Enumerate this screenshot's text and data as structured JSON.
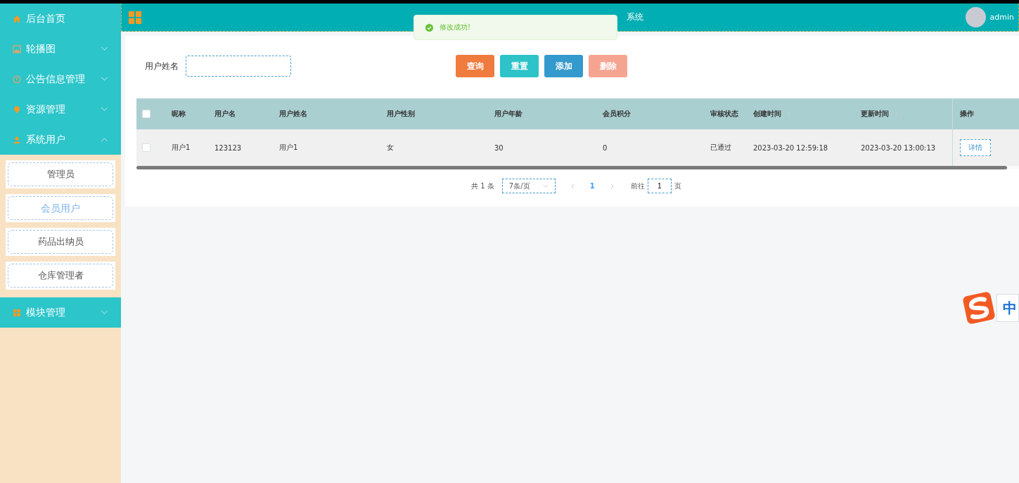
{
  "sidebar": {
    "items": [
      {
        "label": "后台首页",
        "kind": "link"
      },
      {
        "label": "轮播图",
        "kind": "submenu",
        "expanded": false
      },
      {
        "label": "公告信息管理",
        "kind": "submenu",
        "expanded": false
      },
      {
        "label": "资源管理",
        "kind": "submenu",
        "expanded": false
      },
      {
        "label": "系统用户",
        "kind": "submenu",
        "expanded": true,
        "children": [
          {
            "label": "管理员",
            "selected": false
          },
          {
            "label": "会员用户",
            "selected": true
          },
          {
            "label": "药品出纳员",
            "selected": false
          },
          {
            "label": "仓库管理者",
            "selected": false
          }
        ]
      },
      {
        "label": "模块管理",
        "kind": "submenu",
        "expanded": false
      }
    ]
  },
  "header": {
    "title": "系统",
    "user": "admin"
  },
  "toast": {
    "message": "修改成功!"
  },
  "search": {
    "label": "用户姓名"
  },
  "buttons": [
    {
      "label": "查询",
      "kind": "search",
      "disabled": false
    },
    {
      "label": "重置",
      "kind": "reset",
      "disabled": false
    },
    {
      "label": "添加",
      "kind": "add",
      "disabled": false
    },
    {
      "label": "删除",
      "kind": "delete",
      "disabled": true
    }
  ],
  "table": {
    "columns": [
      {
        "label": "昵称",
        "sortable": false
      },
      {
        "label": "用户名",
        "sortable": false
      },
      {
        "label": "用户姓名",
        "sortable": false
      },
      {
        "label": "用户性别",
        "sortable": false
      },
      {
        "label": "用户年龄",
        "sortable": false
      },
      {
        "label": "会员积分",
        "sortable": false
      },
      {
        "label": "审核状态",
        "sortable": false
      },
      {
        "label": "创建时间",
        "sortable": true
      },
      {
        "label": "更新时间",
        "sortable": true
      },
      {
        "label": "操作",
        "sortable": false
      }
    ],
    "all_checked": false,
    "rows": [
      {
        "checked": false,
        "cells": [
          "用户1",
          "123123",
          "用户1",
          "女",
          "30",
          "0",
          "已通过",
          "2023-03-20 12:59:18",
          "2023-03-20 13:00:13"
        ],
        "action": "详情"
      }
    ]
  },
  "pagination": {
    "total": "共 1 条",
    "page_size": "7条/页",
    "pages": [
      {
        "label": "1",
        "selected": true
      }
    ],
    "goto_label": "前往",
    "goto_value": "1",
    "goto_suffix": "页"
  },
  "ime": {
    "mode": "中"
  }
}
